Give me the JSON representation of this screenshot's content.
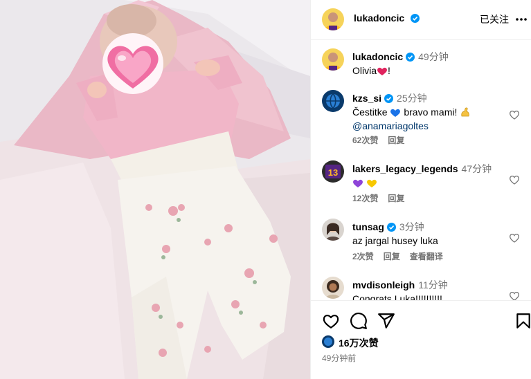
{
  "header": {
    "username": "lukadoncic",
    "follow_status": "已关注"
  },
  "caption": {
    "username": "lukadoncic",
    "time": "49分钟",
    "text_prefix": "Olivia",
    "text_suffix": "!"
  },
  "comments": [
    {
      "username": "kzs_si",
      "verified": true,
      "time": "25分钟",
      "text_a": "Čestitke",
      "text_b": "bravo mami!",
      "mention": "@anamariagoltes",
      "likes": "62次赞",
      "reply": "回复"
    },
    {
      "username": "lakers_legacy_legends",
      "verified": false,
      "time": "47分钟",
      "likes": "12次赞",
      "reply": "回复"
    },
    {
      "username": "tunsag",
      "verified": true,
      "time": "3分钟",
      "text": "az jargal husey luka",
      "likes": "2次赞",
      "reply": "回复",
      "translate": "查看翻译"
    },
    {
      "username": "mvdisonleigh",
      "verified": false,
      "time": "11分钟",
      "text": "Congrats Luka!!!!!!!!!!"
    }
  ],
  "footer": {
    "like_count": "16万次赞",
    "posted_ago": "49分钟前"
  },
  "icons": {
    "verified": "verified-badge-icon",
    "heart": "heart-icon",
    "comment": "comment-icon",
    "share": "share-icon",
    "save": "bookmark-icon",
    "more": "more-icon"
  },
  "colors": {
    "verified": "#0095f6",
    "link": "#00376b",
    "secondary": "#737373",
    "divider": "#efefef"
  }
}
